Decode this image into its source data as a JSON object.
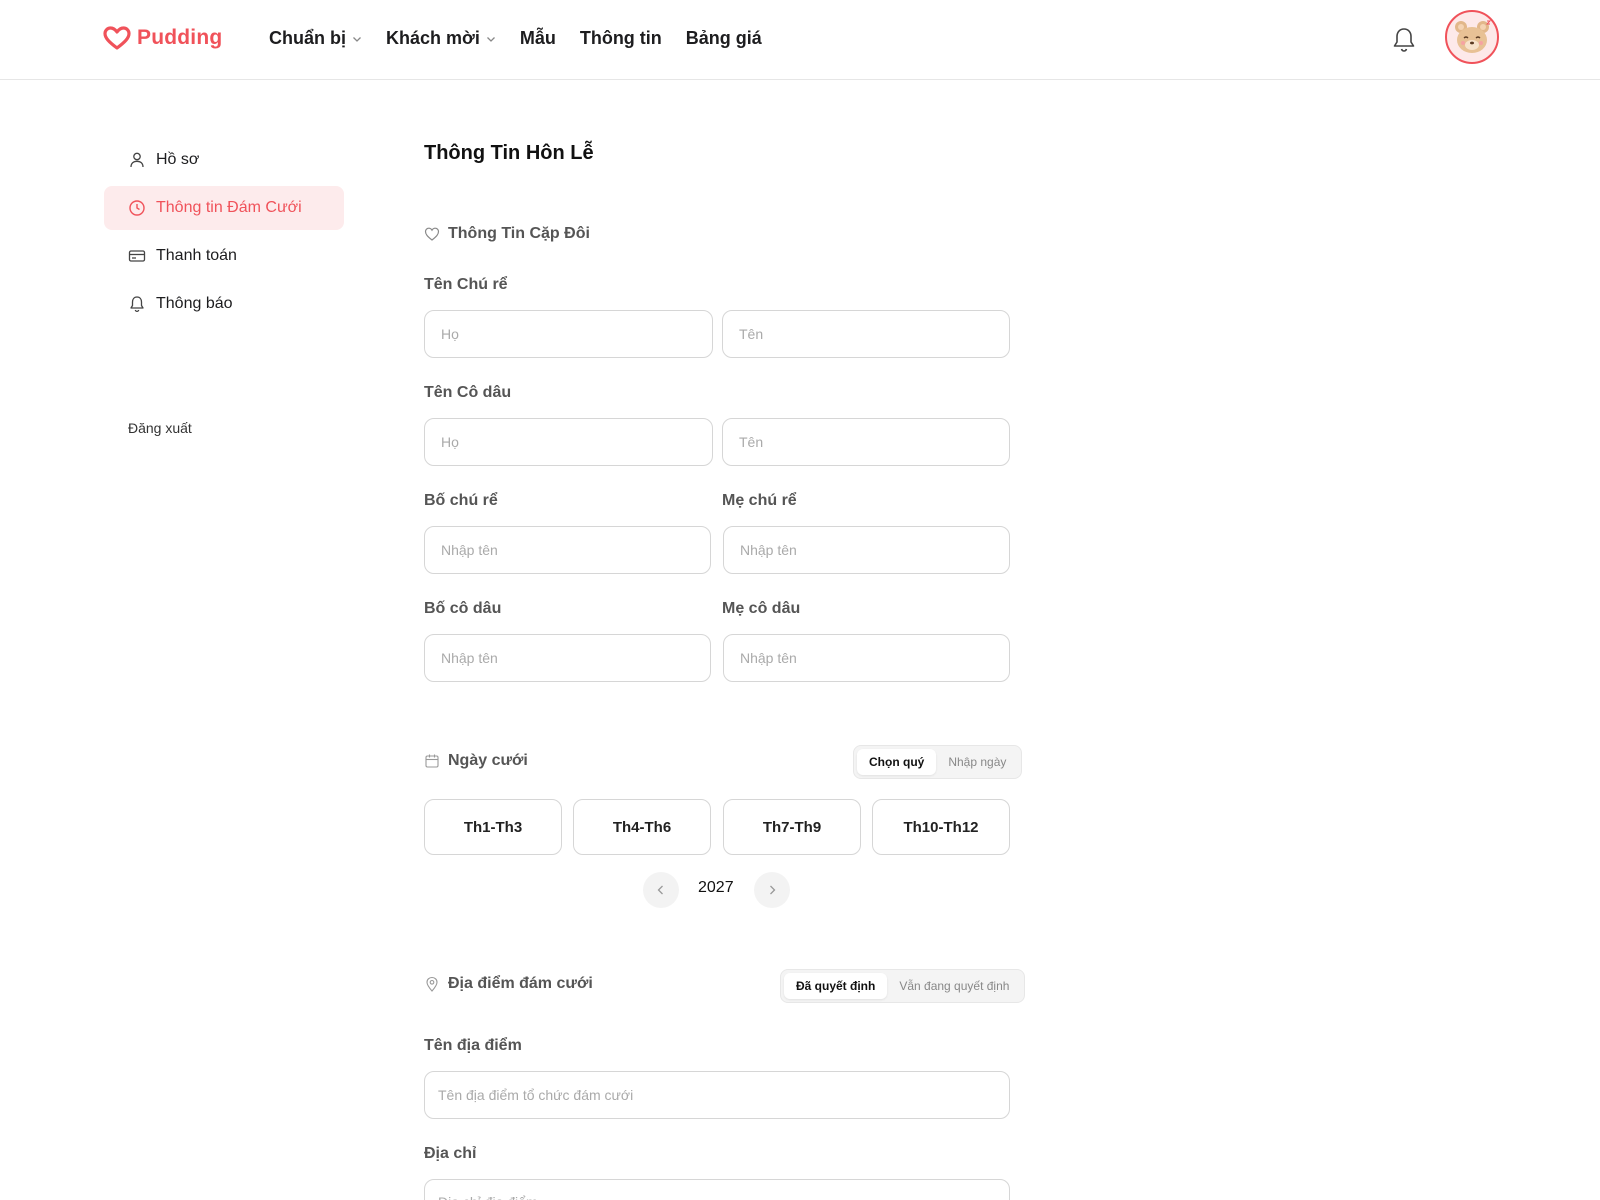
{
  "brand": {
    "name": "Pudding",
    "accent": "#f0525a"
  },
  "nav": [
    {
      "label": "Chuẩn bị",
      "dropdown": true
    },
    {
      "label": "Khách mời",
      "dropdown": true
    },
    {
      "label": "Mẫu",
      "dropdown": false
    },
    {
      "label": "Thông tin",
      "dropdown": false
    },
    {
      "label": "Bảng giá",
      "dropdown": false
    }
  ],
  "sidebar": {
    "items": [
      {
        "label": "Hồ sơ",
        "icon": "user-icon"
      },
      {
        "label": "Thông tin Đám Cưới",
        "icon": "clock-icon",
        "active": true
      },
      {
        "label": "Thanh toán",
        "icon": "card-icon"
      },
      {
        "label": "Thông báo",
        "icon": "bell-icon"
      }
    ],
    "logout": "Đăng xuất"
  },
  "page": {
    "title": "Thông Tin Hôn Lễ"
  },
  "couple": {
    "section_title": "Thông Tin Cặp Đôi",
    "groom_label": "Tên Chú rể",
    "bride_label": "Tên Cô dâu",
    "last_name_placeholder": "Họ",
    "first_name_placeholder": "Tên",
    "groom_father_label": "Bố chú rể",
    "groom_mother_label": "Mẹ chú rể",
    "bride_father_label": "Bố cô dâu",
    "bride_mother_label": "Mẹ cô dâu",
    "name_placeholder": "Nhập tên"
  },
  "wedding_date": {
    "section_title": "Ngày cưới",
    "mode_options": [
      "Chọn quý",
      "Nhập ngày"
    ],
    "selected_mode": "Chọn quý",
    "quarters": [
      "Th1-Th3",
      "Th4-Th6",
      "Th7-Th9",
      "Th10-Th12"
    ],
    "year": "2027"
  },
  "venue": {
    "section_title": "Địa điểm đám cưới",
    "mode_options": [
      "Đã quyết định",
      "Vẫn đang quyết định"
    ],
    "selected_mode": "Đã quyết định",
    "name_label": "Tên địa điểm",
    "name_placeholder": "Tên địa điểm tổ chức đám cưới",
    "address_label": "Địa chỉ",
    "address_placeholder": "Địa chỉ địa điểm"
  }
}
